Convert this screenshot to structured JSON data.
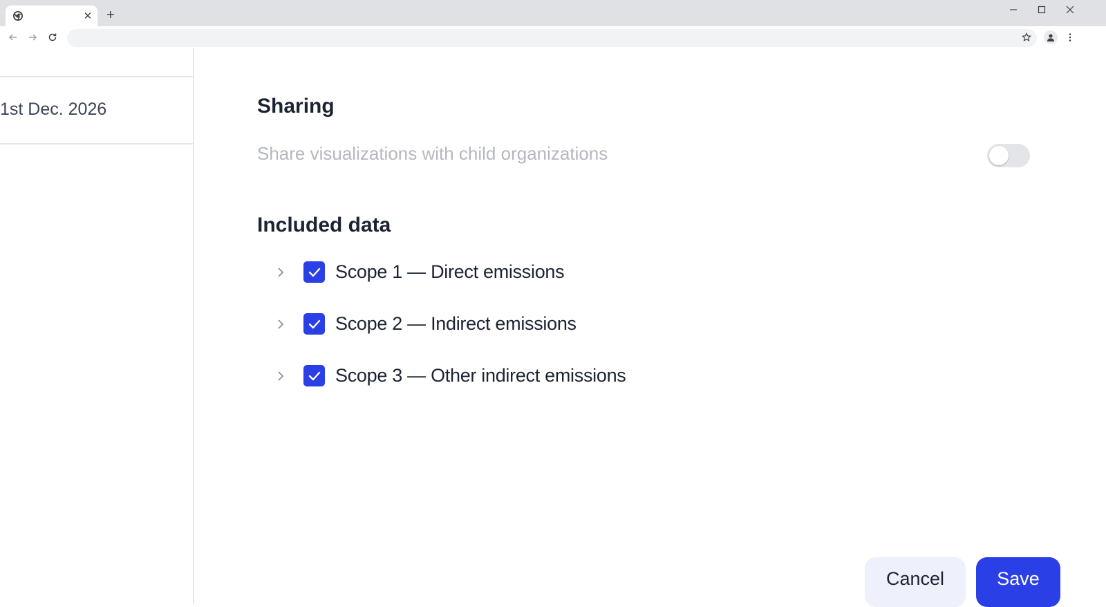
{
  "browser": {
    "tab_close_glyph": "✕",
    "new_tab_glyph": "+",
    "icons": [
      "chrome-favicon-icon",
      "close-icon",
      "plus-icon",
      "minimize-icon",
      "maximize-icon",
      "close-window-icon",
      "back-arrow-icon",
      "forward-arrow-icon",
      "reload-icon",
      "star-icon",
      "profile-icon",
      "kebab-menu-icon"
    ]
  },
  "left_pane": {
    "date_text": "1st Dec. 2026"
  },
  "sharing": {
    "title": "Sharing",
    "toggle_label": "Share visualizations with child organizations",
    "toggle_on": false
  },
  "included_data": {
    "title": "Included data",
    "items": [
      {
        "label": "Scope 1 — Direct emissions",
        "checked": true
      },
      {
        "label": "Scope 2 — Indirect emissions",
        "checked": true
      },
      {
        "label": "Scope 3 — Other indirect emissions",
        "checked": true
      }
    ]
  },
  "actions": {
    "cancel_label": "Cancel",
    "save_label": "Save"
  },
  "colors": {
    "accent": "#2b3fe6",
    "cancel_bg": "#eef1fb",
    "muted_text": "#b4b8bf",
    "heading_text": "#1b2333"
  }
}
